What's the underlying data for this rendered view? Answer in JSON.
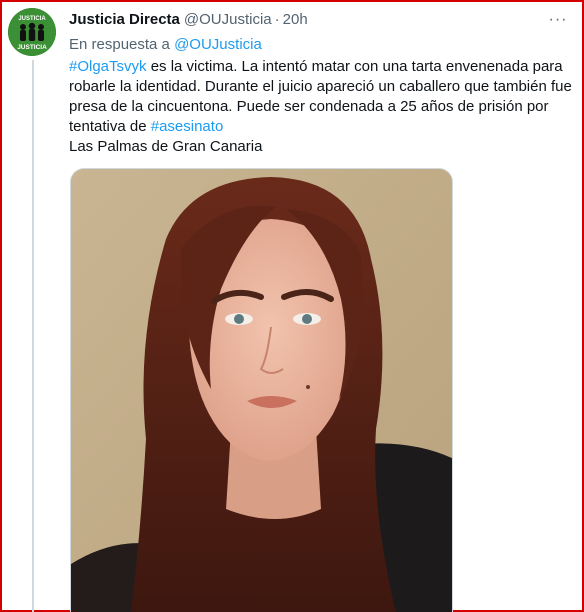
{
  "author": {
    "display_name": "Justicia Directa",
    "handle": "@OUJusticia",
    "time": "20h",
    "avatar_text": [
      "JUSTICIA",
      "JUSTICIA"
    ]
  },
  "reply": {
    "prefix": "En respuesta a",
    "handle": "@OUJusticia"
  },
  "tweet": {
    "hashtag_1": "#OlgaTsvyk",
    "text_1": " es la victima. La intentó matar con una tarta envenenada para robarle la identidad. Durante el juicio apareció un caballero que también fue presa de la cincuentona. Puede ser condenada a 25 años de prisión por tentativa de ",
    "hashtag_2": "#asesinato",
    "location": "Las Palmas de Gran Canaria"
  },
  "icons": {
    "more": "more-horizontal-icon"
  },
  "colors": {
    "link": "#1d9bf0",
    "secondary_text": "#536471",
    "avatar_bg": "#2f7a2a",
    "frame_border": "#d40000"
  }
}
